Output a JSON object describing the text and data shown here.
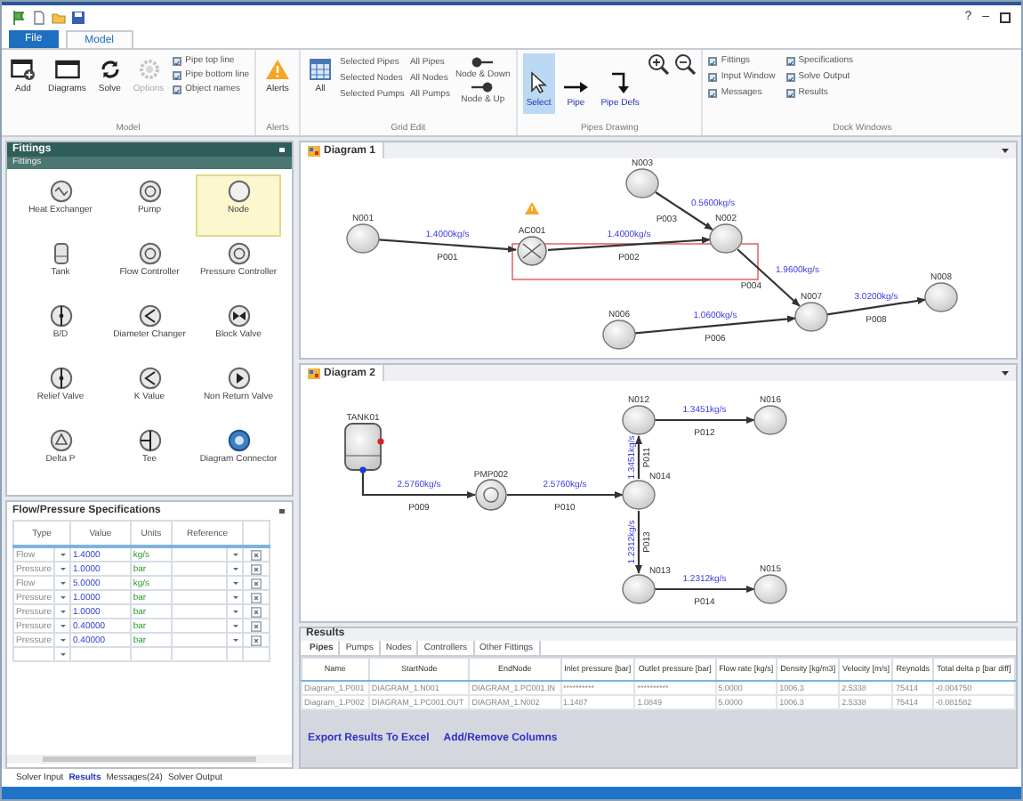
{
  "window": {
    "controls": [
      "?",
      "–"
    ]
  },
  "menu_tabs": [
    {
      "label": "File",
      "kind": "app",
      "selected": false
    },
    {
      "label": "Model",
      "kind": "tab",
      "selected": true
    }
  ],
  "ribbon": {
    "model": {
      "label": "Model",
      "buttons": [
        {
          "label": "Add",
          "disabled": false
        },
        {
          "label": "Diagrams",
          "disabled": false
        },
        {
          "label": "Solve",
          "disabled": false
        },
        {
          "label": "Options",
          "disabled": true
        }
      ],
      "options": [
        {
          "label": "Pipe top line",
          "checked": true
        },
        {
          "label": "Pipe bottom line",
          "checked": true
        },
        {
          "label": "Object names",
          "checked": true
        }
      ]
    },
    "alerts": {
      "label": "Alerts",
      "button": "Alerts"
    },
    "grid_edit": {
      "label": "Grid Edit",
      "all": "All",
      "selected": [
        "Selected Pipes",
        "Selected Nodes",
        "Selected Pumps"
      ],
      "all_items": [
        "All Pipes",
        "All Nodes",
        "All Pumps"
      ],
      "node_down": "Node & Down",
      "node_up": "Node & Up"
    },
    "pipes_drawing": {
      "label": "Pipes Drawing",
      "tools": [
        {
          "label": "Select",
          "selected": true
        },
        {
          "label": "Pipe",
          "selected": false
        },
        {
          "label": "Pipe Defs",
          "selected": false
        }
      ]
    },
    "dock_windows": {
      "label": "Dock Windows",
      "options": [
        {
          "label": "Fittings",
          "checked": true
        },
        {
          "label": "Specifications",
          "checked": true
        },
        {
          "label": "Input Window",
          "checked": true
        },
        {
          "label": "Solve Output",
          "checked": true
        },
        {
          "label": "Messages",
          "checked": true
        },
        {
          "label": "Results",
          "checked": true
        }
      ]
    }
  },
  "fittings": {
    "title": "Fittings",
    "filter": "Fittings",
    "items": [
      {
        "label": "Heat Exchanger",
        "selected": false
      },
      {
        "label": "Pump",
        "selected": false
      },
      {
        "label": "Node",
        "selected": true
      },
      {
        "label": "Tank",
        "selected": false
      },
      {
        "label": "Flow Controller",
        "selected": false
      },
      {
        "label": "Pressure Controller",
        "selected": false
      },
      {
        "label": "B/D",
        "selected": false
      },
      {
        "label": "Diameter Changer",
        "selected": false
      },
      {
        "label": "Block Valve",
        "selected": false
      },
      {
        "label": "Relief Valve",
        "selected": false
      },
      {
        "label": "K Value",
        "selected": false
      },
      {
        "label": "Non Return Valve",
        "selected": false
      },
      {
        "label": "Delta P",
        "selected": false
      },
      {
        "label": "Tee",
        "selected": false
      },
      {
        "label": "Diagram Connector",
        "selected": false
      }
    ]
  },
  "specifications": {
    "title": "Flow/Pressure Specifications",
    "columns": [
      "Type",
      "Value",
      "Units",
      "Reference"
    ],
    "rows": [
      {
        "type": "Flow",
        "value": "1.4000",
        "units": "kg/s"
      },
      {
        "type": "Pressure",
        "value": "1.0000",
        "units": "bar"
      },
      {
        "type": "Flow",
        "value": "5.0000",
        "units": "kg/s"
      },
      {
        "type": "Pressure",
        "value": "1.0000",
        "units": "bar"
      },
      {
        "type": "Pressure",
        "value": "1.0000",
        "units": "bar"
      },
      {
        "type": "Pressure",
        "value": "0.40000",
        "units": "bar"
      },
      {
        "type": "Pressure",
        "value": "0.40000",
        "units": "bar"
      }
    ]
  },
  "diagrams": [
    {
      "title": "Diagram 1",
      "nodes": [
        {
          "label": "N001",
          "kind": "node"
        },
        {
          "label": "AC001",
          "kind": "valve"
        },
        {
          "label": "N003",
          "kind": "node"
        },
        {
          "label": "N002",
          "kind": "node"
        },
        {
          "label": "N007",
          "kind": "node"
        },
        {
          "label": "N008",
          "kind": "node"
        },
        {
          "label": "N006",
          "kind": "node"
        }
      ],
      "pipes": [
        {
          "flow": "1.4000kg/s",
          "name": "P001"
        },
        {
          "flow": "1.4000kg/s",
          "name": "P002"
        },
        {
          "flow": "0.5600kg/s",
          "name": "P003"
        },
        {
          "flow": "1.9600kg/s",
          "name": "P004"
        },
        {
          "flow": "1.0600kg/s",
          "name": "P006"
        },
        {
          "flow": "3.0200kg/s",
          "name": "P008"
        }
      ]
    },
    {
      "title": "Diagram 2",
      "nodes": [
        {
          "label": "TANK01",
          "kind": "tank"
        },
        {
          "label": "N012",
          "kind": "node"
        },
        {
          "label": "N016",
          "kind": "node"
        },
        {
          "label": "PMP002",
          "kind": "pump"
        },
        {
          "label": "N014",
          "kind": "node"
        },
        {
          "label": "N013",
          "kind": "node"
        },
        {
          "label": "N015",
          "kind": "node"
        }
      ],
      "pipes": [
        {
          "flow": "2.5760kg/s",
          "name": "P009"
        },
        {
          "flow": "2.5760kg/s",
          "name": "P010"
        },
        {
          "flow": "1.3451kg/s",
          "name": "P011"
        },
        {
          "flow": "1.3451kg/s",
          "name": "P012"
        },
        {
          "flow": "1.2312kg/s",
          "name": "P013"
        },
        {
          "flow": "1.2312kg/s",
          "name": "P014"
        }
      ]
    }
  ],
  "results": {
    "title": "Results",
    "tabs": [
      {
        "label": "Pipes",
        "selected": true
      },
      {
        "label": "Pumps",
        "selected": false
      },
      {
        "label": "Nodes",
        "selected": false
      },
      {
        "label": "Controllers",
        "selected": false
      },
      {
        "label": "Other Fittings",
        "selected": false
      }
    ],
    "columns": [
      "Name",
      "StartNode",
      "EndNode",
      "Inlet pressure [bar]",
      "Outlet pressure [bar]",
      "Flow rate [kg/s]",
      "Density [kg/m3]",
      "Velocity [m/s]",
      "Reynolds",
      "Total delta p [bar diff]"
    ],
    "rows": [
      [
        "Diagram_1.P001",
        "DIAGRAM_1.N001",
        "DIAGRAM_1.PC001.IN",
        "**********",
        "**********",
        "5.0000",
        "1006.3",
        "2.5338",
        "75414",
        "-0.004750"
      ],
      [
        "Diagram_1.P002",
        "DIAGRAM_1.PC001.OUT",
        "DIAGRAM_1.N002",
        "1.1487",
        "1.0849",
        "5.0000",
        "1006.3",
        "2.5338",
        "75414",
        "-0.081582"
      ]
    ],
    "links": [
      "Export Results To Excel",
      "Add/Remove Columns"
    ]
  },
  "bottom_tabs": [
    {
      "label": "Solver Input",
      "selected": false
    },
    {
      "label": "Results",
      "selected": true
    },
    {
      "label": "Messages(24)",
      "selected": false
    },
    {
      "label": "Solver Output",
      "selected": false
    }
  ]
}
